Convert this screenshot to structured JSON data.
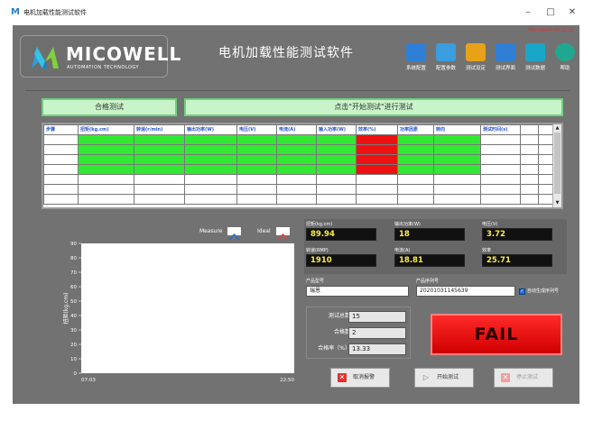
{
  "window": {
    "title": "电机加载性能测试软件",
    "min_glyph": "–",
    "max_glyph": "□",
    "close_glyph": "✕"
  },
  "header": {
    "version": "Micowell-V6.2.16",
    "logo_text": "MICOWELL",
    "logo_sub": "AUTOMATION TECHNOLOGY",
    "title": "电机加载性能测试软件"
  },
  "toolbar": [
    {
      "label": "系统配置",
      "icon": "system-config-icon",
      "color": "#2f7fd6"
    },
    {
      "label": "配置参数",
      "icon": "sliders-icon",
      "color": "#3a9de0"
    },
    {
      "label": "测试设定",
      "icon": "clipboard-icon",
      "color": "#e8a21a"
    },
    {
      "label": "测试界面",
      "icon": "monitor-icon",
      "color": "#2f7fd6"
    },
    {
      "label": "测试数据",
      "icon": "data-chart-icon",
      "color": "#1aa6c9"
    },
    {
      "label": "帮助",
      "icon": "help-icon",
      "color": "#1fa88f"
    }
  ],
  "banners": {
    "left": "合格测试",
    "right": "点击\"开始测试\"进行测试"
  },
  "table": {
    "columns": [
      "步骤",
      "扭矩(kg.cm)",
      "转速(r/min)",
      "输出功率(W)",
      "电压(V)",
      "电流(A)",
      "输入功率(W)",
      "效率(%)",
      "功率因素",
      "转向",
      "测试时间(s)",
      "",
      ""
    ],
    "rows": [
      [
        "ok",
        "ok",
        "ok",
        "ok",
        "ok",
        "ok",
        "bad",
        "ok",
        "ok"
      ],
      [
        "ok",
        "ok",
        "ok",
        "ok",
        "ok",
        "ok",
        "bad",
        "ok",
        "ok"
      ],
      [
        "ok",
        "ok",
        "ok",
        "ok",
        "ok",
        "ok",
        "bad",
        "ok",
        "ok"
      ],
      [
        "ok",
        "ok",
        "ok",
        "ok",
        "ok",
        "ok",
        "bad",
        "ok",
        "ok"
      ],
      [
        "",
        "",
        "",
        "",
        "",
        "",
        "",
        "",
        ""
      ],
      [
        "",
        "",
        "",
        "",
        "",
        "",
        "",
        "",
        ""
      ],
      [
        "",
        "",
        "",
        "",
        "",
        "",
        "",
        "",
        ""
      ]
    ]
  },
  "chart_data": {
    "type": "line",
    "ylabel": "扭矩(kg.cm)",
    "ylim": [
      0,
      90
    ],
    "yticks": [
      0,
      10,
      20,
      30,
      40,
      50,
      60,
      70,
      80,
      90
    ],
    "xticks": [
      "07:03",
      "22:50"
    ],
    "series": [
      {
        "name": "Measure",
        "values": []
      },
      {
        "name": "Ideal",
        "values": []
      }
    ],
    "legend_colors": {
      "Measure": "#2a6ad0",
      "Ideal": "#e04040"
    }
  },
  "readouts": [
    {
      "label": "扭矩(kg.cm)",
      "value": "89.94"
    },
    {
      "label": "输出功率(W)",
      "value": "18"
    },
    {
      "label": "电压(V)",
      "value": "3.72"
    },
    {
      "label": "转速(RMP)",
      "value": "1910"
    },
    {
      "label": "电流(A)",
      "value": "18.81"
    },
    {
      "label": "效率",
      "value": "25.71"
    }
  ],
  "product": {
    "model_label": "产品型号",
    "model_value": "瑞恩",
    "serial_label": "产品序列号",
    "serial_value": "20201031145639",
    "auto_label": "自动生成序列号",
    "auto_checked": true
  },
  "stats": [
    {
      "label": "测试总数",
      "value": "15"
    },
    {
      "label": "合格数",
      "value": "2"
    },
    {
      "label": "合格率（%）",
      "value": "13.33"
    }
  ],
  "result": "FAIL",
  "buttons": {
    "cancel": "取消报警",
    "start": "开始测试",
    "stop": "停止测试"
  }
}
